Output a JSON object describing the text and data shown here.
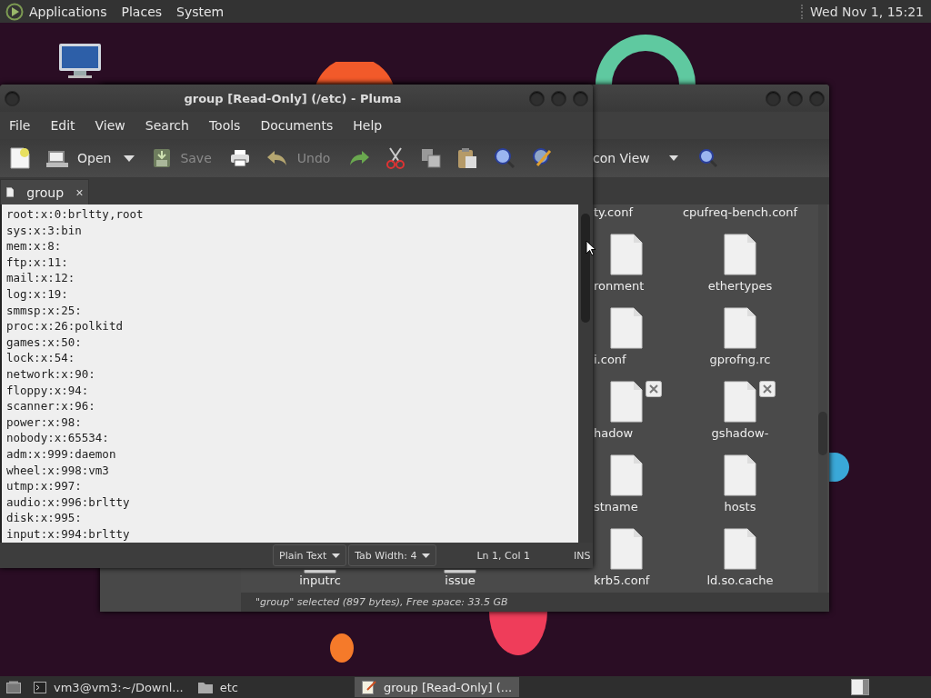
{
  "top_panel": {
    "menus": [
      "Applications",
      "Places",
      "System"
    ],
    "clock": "Wed Nov 1, 15:21"
  },
  "file_manager": {
    "view_selector": "con View",
    "top_labels": [
      "ty.conf",
      "cpufreq-bench.conf"
    ],
    "rows": [
      {
        "items": [
          {
            "name": "ronment",
            "unreadable": false
          },
          {
            "name": "ethertypes",
            "unreadable": false
          }
        ]
      },
      {
        "items": [
          {
            "name": "i.conf",
            "unreadable": false
          },
          {
            "name": "gprofng.rc",
            "unreadable": false
          }
        ]
      },
      {
        "items": [
          {
            "name": "hadow",
            "unreadable": true
          },
          {
            "name": "gshadow-",
            "unreadable": true
          }
        ]
      },
      {
        "items": [
          {
            "name": "stname",
            "unreadable": false
          },
          {
            "name": "hosts",
            "unreadable": false
          }
        ]
      }
    ],
    "last_row": {
      "covered_labels": [
        "inputrc",
        "issue"
      ],
      "items": [
        {
          "name": "krb5.conf",
          "unreadable": false
        },
        {
          "name": "ld.so.cache",
          "unreadable": false
        }
      ]
    },
    "status": "\"group\" selected (897 bytes), Free space: 33.5 GB"
  },
  "editor": {
    "title": "group [Read-Only] (/etc) - Pluma",
    "menu": [
      "File",
      "Edit",
      "View",
      "Search",
      "Tools",
      "Documents",
      "Help"
    ],
    "toolbar": [
      {
        "kind": "new",
        "disabled": false
      },
      {
        "kind": "open",
        "label": "Open",
        "disabled": false
      },
      {
        "kind": "dropdown",
        "disabled": false
      },
      {
        "kind": "save",
        "label": "Save",
        "disabled": true
      },
      {
        "kind": "print",
        "disabled": false
      },
      {
        "kind": "undo",
        "label": "Undo",
        "disabled": true
      },
      {
        "kind": "redo",
        "disabled": false
      },
      {
        "kind": "cut",
        "disabled": false
      },
      {
        "kind": "copy",
        "disabled": false
      },
      {
        "kind": "paste",
        "disabled": false
      },
      {
        "kind": "find",
        "disabled": false
      },
      {
        "kind": "replace",
        "disabled": false
      }
    ],
    "tabs": [
      {
        "label": "group",
        "selected": true
      }
    ],
    "lines": [
      "root:x:0:brltty,root",
      "sys:x:3:bin",
      "mem:x:8:",
      "ftp:x:11:",
      "mail:x:12:",
      "log:x:19:",
      "smmsp:x:25:",
      "proc:x:26:polkitd",
      "games:x:50:",
      "lock:x:54:",
      "network:x:90:",
      "floppy:x:94:",
      "scanner:x:96:",
      "power:x:98:",
      "nobody:x:65534:",
      "adm:x:999:daemon",
      "wheel:x:998:vm3",
      "utmp:x:997:",
      "audio:x:996:brltty",
      "disk:x:995:",
      "input:x:994:brltty"
    ],
    "status": {
      "language": "Plain Text",
      "tab_width": "Tab Width:  4",
      "position": "Ln 1, Col 1",
      "mode": "INS"
    }
  },
  "taskbar": {
    "tasks": [
      {
        "kind": "terminal",
        "label": "vm3@vm3:~/Downl...",
        "selected": false
      },
      {
        "kind": "folder",
        "label": "etc",
        "selected": false
      },
      {
        "kind": "editor",
        "label": "group [Read-Only] (...",
        "selected": true
      }
    ]
  }
}
